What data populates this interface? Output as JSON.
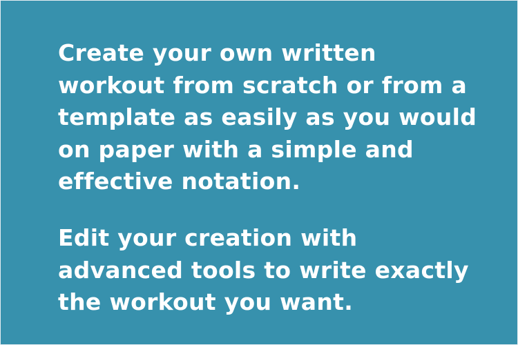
{
  "paragraphs": {
    "p1": "Create your own written\nworkout from scratch or from a\ntemplate as easily as you would\non paper with a simple and\neffective notation.",
    "p2": "Edit your creation with\nadvanced tools to write exactly\nthe workout you want."
  },
  "colors": {
    "background": "#3791ad",
    "text": "#ffffff"
  }
}
